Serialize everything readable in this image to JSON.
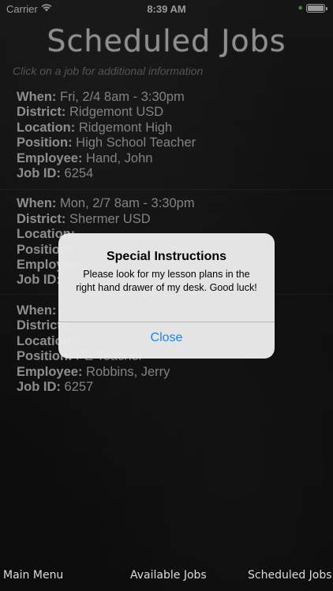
{
  "status": {
    "carrier": "Carrier",
    "time": "8:39 AM",
    "wifi_icon": "wifi-icon",
    "battery_icon": "battery-icon"
  },
  "header": {
    "title": "Scheduled Jobs",
    "subtitle": "Click on a job for additional information"
  },
  "labels": {
    "when": "When:",
    "district": "District:",
    "location": "Location:",
    "position": "Position:",
    "employee": "Employee:",
    "job_id": "Job ID:"
  },
  "jobs": [
    {
      "when": "Fri, 2/4 8am - 3:30pm",
      "district": "Ridgemont USD",
      "location": "Ridgemont High",
      "position": "High School Teacher",
      "employee": "Hand, John",
      "job_id": "6254"
    },
    {
      "when": "Mon, 2/7 8am - 3:30pm",
      "district": "Shermer USD",
      "location": "",
      "position": "",
      "employee": "",
      "job_id": ""
    },
    {
      "when": "",
      "district": "",
      "location": "",
      "position": "PE Teacher",
      "employee": "Robbins, Jerry",
      "job_id": "6257"
    }
  ],
  "alert": {
    "title": "Special Instructions",
    "message": "Please look for my lesson plans in the right hand drawer of my desk. Good luck!",
    "close_label": "Close"
  },
  "tabs": {
    "main_menu": "Main Menu",
    "available_jobs": "Available Jobs",
    "scheduled_jobs": "Scheduled Jobs"
  },
  "colors": {
    "alert_button": "#1a82fb",
    "background": "#1b1b1b"
  }
}
